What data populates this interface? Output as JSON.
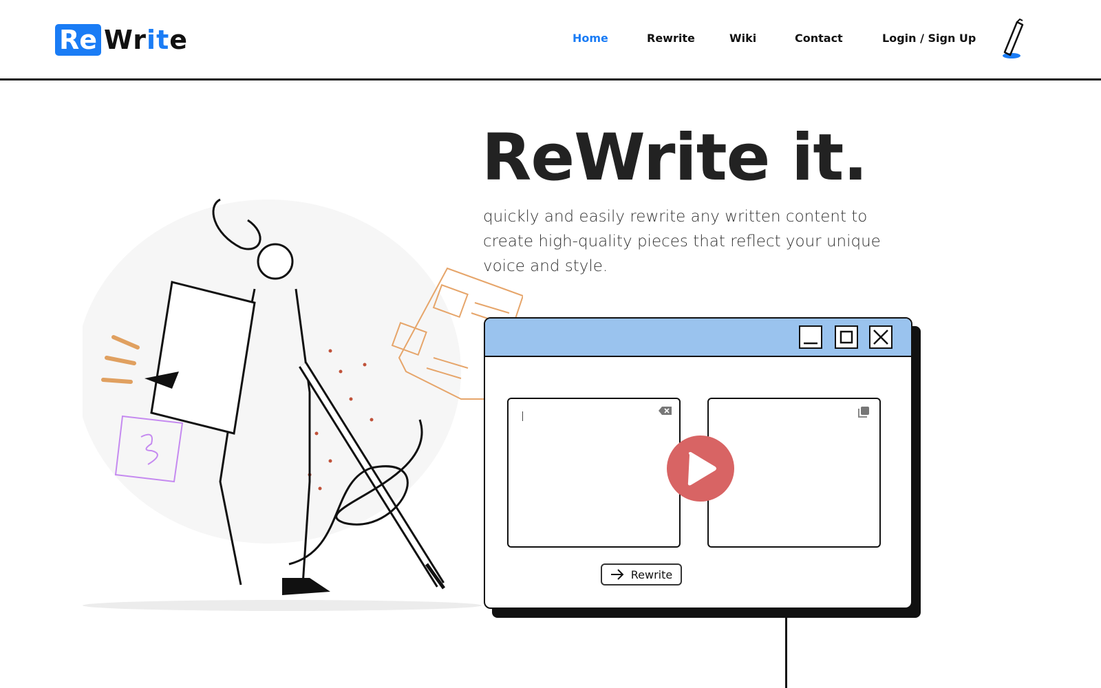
{
  "brand": {
    "logo_text": "ReWrite",
    "accent": "#1a7cf5"
  },
  "nav": {
    "items": [
      {
        "label": "Home",
        "active": true
      },
      {
        "label": "Rewrite",
        "active": false
      },
      {
        "label": "Wiki",
        "active": false
      },
      {
        "label": "Contact",
        "active": false
      },
      {
        "label": "Login / Sign Up",
        "active": false
      }
    ],
    "icon": "pen-icon"
  },
  "hero": {
    "title": "ReWrite it.",
    "subtitle": "quickly and easily rewrite any written content to create high-quality pieces that reflect your unique voice and style."
  },
  "app_window": {
    "titlebar_color": "#9ac3ee",
    "controls": [
      "minimize-icon",
      "maximize-icon",
      "close-icon"
    ],
    "input_value": "",
    "output_value": "",
    "play_color": "#d86464",
    "rewrite_label": "Rewrite"
  }
}
